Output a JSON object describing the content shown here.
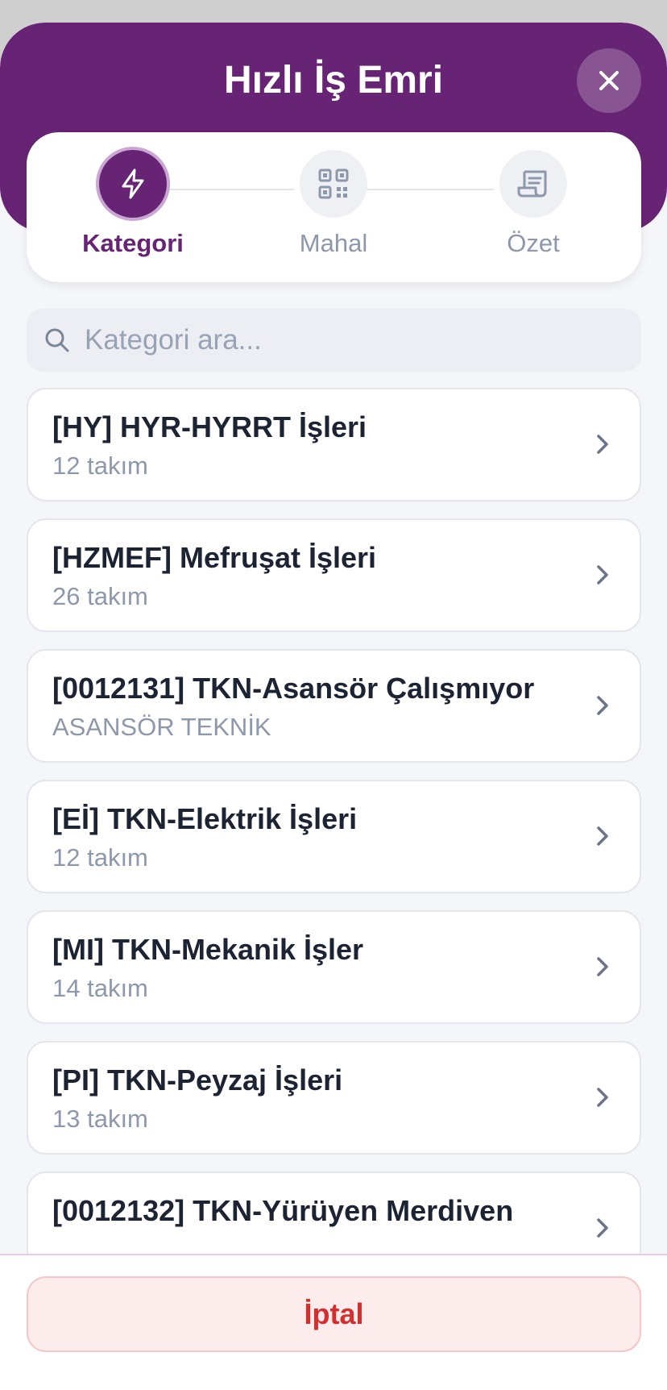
{
  "header": {
    "title": "Hızlı İş Emri"
  },
  "steps": [
    {
      "label": "Kategori",
      "icon": "bolt-icon",
      "active": true
    },
    {
      "label": "Mahal",
      "icon": "qr-code-icon",
      "active": false
    },
    {
      "label": "Özet",
      "icon": "receipt-icon",
      "active": false
    }
  ],
  "search": {
    "placeholder": "Kategori ara..."
  },
  "categories": [
    {
      "title": "[HY] HYR-HYRRT İşleri",
      "subtitle": "12 takım"
    },
    {
      "title": "[HZMEF] Mefruşat İşleri",
      "subtitle": "26 takım"
    },
    {
      "title": "[0012131] TKN-Asansör Çalışmıyor",
      "subtitle": "ASANSÖR TEKNİK"
    },
    {
      "title": "[Eİ] TKN-Elektrik İşleri",
      "subtitle": "12 takım"
    },
    {
      "title": "[MI] TKN-Mekanik İşler",
      "subtitle": "14 takım"
    },
    {
      "title": "[PI] TKN-Peyzaj İşleri",
      "subtitle": "13 takım"
    },
    {
      "title": "[0012132] TKN-Yürüyen Merdiven",
      "subtitle": ""
    }
  ],
  "footer": {
    "cancel_label": "İptal"
  },
  "colors": {
    "brand": "#682474",
    "danger": "#d32f2f"
  }
}
